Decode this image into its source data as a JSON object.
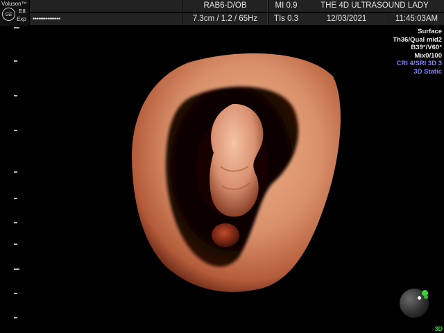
{
  "header": {
    "brand": "Voluson™",
    "logo": "GE",
    "model": "E8",
    "edition": "Exp",
    "probe": "RAB6-D/OB",
    "mi": "MI  0.9",
    "facility": "THE 4D ULTRASOUND LADY",
    "progress_dots": "•••••••••••••••",
    "depth_info": "7.3cm / 1.2 / 65Hz",
    "tis": "TIs  0.3",
    "date": "12/03/2021",
    "time": "11:45:03AM"
  },
  "params": {
    "render_mode": "Surface",
    "threshold": "Th36/Qual mid2",
    "angles": "B39°/V60°",
    "mix": "Mix0/100",
    "cri": "CRI 4/SRI 3D 3",
    "mode": "3D Static"
  },
  "corner_label": "3D",
  "colors": {
    "tissue": "#d8906a",
    "tissue_dark": "#8a3a22",
    "bar": "#222222",
    "accent_blue": "#8080ff",
    "accent_green": "#3bd23b"
  }
}
